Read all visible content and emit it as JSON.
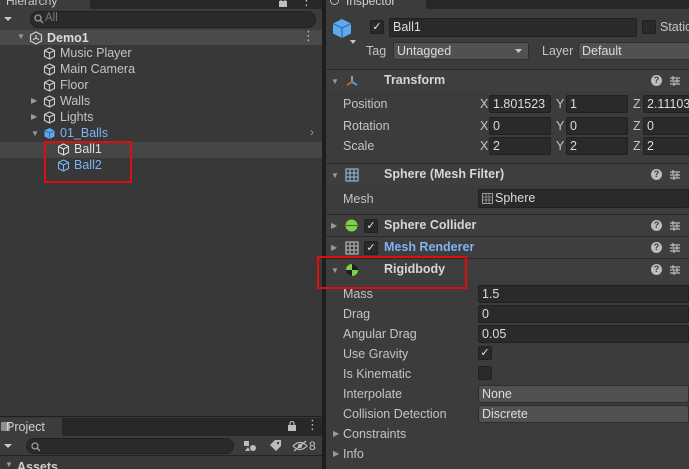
{
  "hierarchy": {
    "title": "Hierarchy",
    "search_placeholder": "All",
    "scene": "Demo1",
    "items": [
      {
        "label": "Music Player"
      },
      {
        "label": "Main Camera"
      },
      {
        "label": "Floor"
      },
      {
        "label": "Walls"
      },
      {
        "label": "Lights"
      },
      {
        "label": "01_Balls"
      },
      {
        "label": "Ball1"
      },
      {
        "label": "Ball2"
      }
    ]
  },
  "project": {
    "title": "Project",
    "hidden_count": "8",
    "folder": "Assets"
  },
  "inspector": {
    "title": "Inspector",
    "object_name": "Ball1",
    "static_label": "Static",
    "tag_label": "Tag",
    "tag_value": "Untagged",
    "layer_label": "Layer",
    "layer_value": "Default",
    "transform": {
      "title": "Transform",
      "position_label": "Position",
      "rotation_label": "Rotation",
      "scale_label": "Scale",
      "axis_x": "X",
      "axis_y": "Y",
      "axis_z": "Z",
      "position": {
        "x": "1.801523",
        "y": "1",
        "z": "2.11103"
      },
      "rotation": {
        "x": "0",
        "y": "0",
        "z": "0"
      },
      "scale": {
        "x": "2",
        "y": "2",
        "z": "2"
      }
    },
    "mesh_filter": {
      "title": "Sphere (Mesh Filter)",
      "mesh_label": "Mesh",
      "mesh_value": "Sphere"
    },
    "sphere_collider": {
      "title": "Sphere Collider"
    },
    "mesh_renderer": {
      "title": "Mesh Renderer"
    },
    "rigidbody": {
      "title": "Rigidbody",
      "mass_label": "Mass",
      "mass": "1.5",
      "drag_label": "Drag",
      "drag": "0",
      "angular_drag_label": "Angular Drag",
      "angular_drag": "0.05",
      "use_gravity_label": "Use Gravity",
      "is_kinematic_label": "Is Kinematic",
      "interpolate_label": "Interpolate",
      "interpolate": "None",
      "collision_label": "Collision Detection",
      "collision": "Discrete",
      "constraints_label": "Constraints",
      "info_label": "Info"
    }
  },
  "colors": {
    "accent_blue": "#7cb3f4",
    "highlight_red": "#e00d0d",
    "panel": "#383838"
  }
}
